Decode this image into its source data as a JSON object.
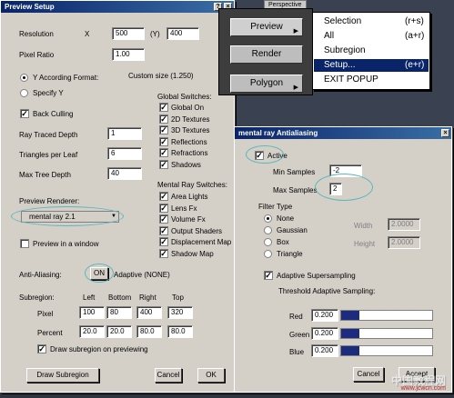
{
  "viewport": {
    "label": "Perspective"
  },
  "preview_setup": {
    "title": "Preview Setup",
    "resolution_label": "Resolution",
    "x_label": "X",
    "y_label": "(Y)",
    "res_x": "500",
    "res_y": "400",
    "pixel_ratio_label": "Pixel Ratio",
    "pixel_ratio": "1.00",
    "y_according": "Y According Format:",
    "custom_size": "Custom size (1.250)",
    "specify_y": "Specify Y",
    "back_culling": "Back Culling",
    "ray_traced_depth_label": "Ray Traced Depth",
    "ray_traced_depth": "1",
    "triangles_per_leaf_label": "Triangles per Leaf",
    "triangles_per_leaf": "6",
    "max_tree_depth_label": "Max Tree Depth",
    "max_tree_depth": "40",
    "global_switches_label": "Global Switches:",
    "global_switches": [
      "Global On",
      "2D Textures",
      "3D Textures",
      "Reflections",
      "Refractions",
      "Shadows"
    ],
    "mr_switches_label": "Mental Ray Switches:",
    "mr_switches": [
      "Area Lights",
      "Lens Fx",
      "Volume Fx",
      "Output Shaders",
      "Displacement Map",
      "Shadow Map"
    ],
    "preview_renderer_label": "Preview Renderer:",
    "preview_renderer": "mental ray 2.1",
    "preview_in_window": "Preview in a window",
    "anti_aliasing_label": "Anti-Aliasing:",
    "anti_aliasing_btn": "ON",
    "adaptive_label": "Adaptive (NONE)",
    "subregion_label": "Subregion:",
    "col_left": "Left",
    "col_bottom": "Bottom",
    "col_right": "Right",
    "col_top": "Top",
    "pixel_label": "Pixel",
    "pixel_values": [
      "100",
      "80",
      "400",
      "320"
    ],
    "percent_label": "Percent",
    "percent_values": [
      "20.0",
      "20.0",
      "80.0",
      "80.0"
    ],
    "draw_on_preview": "Draw subregion on previewing",
    "draw_subregion_btn": "Draw Subregion",
    "cancel_btn": "Cancel",
    "ok_btn": "OK"
  },
  "menu": {
    "preview": "Preview",
    "render": "Render",
    "polygon": "Polygon",
    "popup_items": [
      {
        "label": "Selection",
        "shortcut": "(r+s)"
      },
      {
        "label": "All",
        "shortcut": "(a+r)"
      },
      {
        "label": "Subregion",
        "shortcut": ""
      },
      {
        "label": "Setup...",
        "shortcut": "(e+r)"
      },
      {
        "label": "EXIT POPUP",
        "shortcut": ""
      }
    ]
  },
  "mental_ray": {
    "title": "mental ray Antialiasing",
    "active": "Active",
    "min_samples_label": "Min Samples",
    "min_samples": "-2",
    "max_samples_label": "Max Samples",
    "max_samples": "2",
    "filter_type_label": "Filter Type",
    "filters": [
      "None",
      "Gaussian",
      "Box",
      "Triangle"
    ],
    "width_label": "Width",
    "width_value": "2.0000",
    "height_label": "Height",
    "height_value": "2.0000",
    "adaptive_supersampling": "Adaptive Supersampling",
    "threshold_label": "Threshold Adaptive Sampling:",
    "red_label": "Red",
    "red_value": "0.200",
    "green_label": "Green",
    "green_value": "0.200",
    "blue_label": "Blue",
    "blue_value": "0.200",
    "threshold_fraction": 0.2,
    "cancel_btn": "Cancel",
    "accept_btn": "Accept"
  },
  "watermark": {
    "text": "中国教程网",
    "url": "www.jcwcn.com"
  },
  "colors": {
    "titlebar": "#0a246a",
    "highlight": "#5bb6bd",
    "selection": "#0a246a"
  }
}
